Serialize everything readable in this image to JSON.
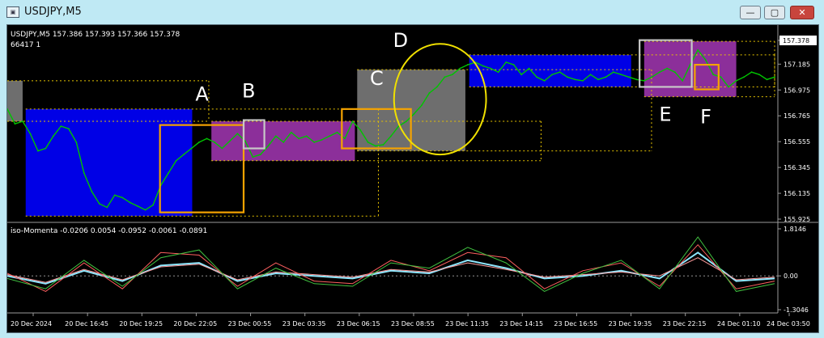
{
  "window": {
    "title": "USDJPY,M5",
    "icons": [
      "chart-window-icon",
      "minimize-icon",
      "maximize-icon",
      "close-icon"
    ],
    "buttons": {
      "minimize": "—",
      "maximize": "▢",
      "close": "✕"
    }
  },
  "colors": {
    "background": "#000000",
    "price_line": "#00c400",
    "blue_box": "#0000e6",
    "magenta_box": "#8c2f9a",
    "gray_box": "#6e6e6e",
    "orange": "#f5a300",
    "yellow": "#f0e000",
    "silver": "#c8c8c8",
    "dotted": "#e6c300",
    "momentum_red": "#ff6060",
    "momentum_pink": "#ff9c9c",
    "momentum_cyan": "#8fe8ff",
    "momentum_green": "#40c040"
  },
  "chart_data": [
    {
      "type": "line",
      "header": "USDJPY,M5  157.386 157.393 157.366 157.378",
      "subheader": "66417  1",
      "ylim": [
        155.925,
        157.45
      ],
      "y_ticks": [
        "157.378",
        "157.185",
        "156.975",
        "156.765",
        "156.555",
        "156.345",
        "156.135",
        "155.925"
      ],
      "y_tick_values": [
        157.378,
        157.185,
        156.975,
        156.765,
        156.555,
        156.345,
        156.135,
        155.925
      ],
      "current_price": "157.378",
      "x_ticks": [
        "20 Dec 2024",
        "20 Dec 16:45",
        "20 Dec 19:25",
        "20 Dec 22:05",
        "23 Dec 00:55",
        "23 Dec 03:35",
        "23 Dec 06:15",
        "23 Dec 08:55",
        "23 Dec 11:35",
        "23 Dec 14:15",
        "23 Dec 16:55",
        "23 Dec 19:35",
        "23 Dec 22:15",
        "24 Dec 01:10",
        "24 Dec 03:50"
      ],
      "x_range": [
        0,
        100
      ],
      "series": [
        {
          "x": [
            0,
            1,
            2,
            3,
            4,
            5,
            6,
            7,
            8,
            9,
            10,
            11,
            12,
            13,
            14,
            15,
            16,
            17,
            18,
            19,
            20,
            21,
            22,
            23,
            24,
            25,
            26,
            27,
            28,
            29,
            30,
            31,
            32,
            33,
            34,
            35,
            36,
            37,
            38,
            39,
            40,
            41,
            42,
            43,
            44,
            45,
            46,
            47,
            48,
            49,
            50,
            51,
            52,
            53,
            54,
            55,
            56,
            57,
            58,
            59,
            60,
            61,
            62,
            63,
            64,
            65,
            66,
            67,
            68,
            69,
            70,
            71,
            72,
            73,
            74,
            75,
            76,
            77,
            78,
            79,
            80,
            81,
            82,
            83,
            84,
            85,
            86,
            87,
            88,
            89,
            90,
            91,
            92,
            93,
            94,
            95,
            96,
            97,
            98,
            99,
            100
          ],
          "values": [
            156.82,
            156.7,
            156.72,
            156.62,
            156.48,
            156.5,
            156.6,
            156.68,
            156.66,
            156.55,
            156.3,
            156.15,
            156.05,
            156.02,
            156.12,
            156.1,
            156.06,
            156.03,
            156.0,
            156.04,
            156.2,
            156.3,
            156.4,
            156.45,
            156.5,
            156.55,
            156.58,
            156.55,
            156.5,
            156.56,
            156.62,
            156.56,
            156.43,
            156.45,
            156.52,
            156.6,
            156.55,
            156.63,
            156.58,
            156.6,
            156.55,
            156.57,
            156.6,
            156.63,
            156.58,
            156.72,
            156.65,
            156.55,
            156.52,
            156.53,
            156.6,
            156.68,
            156.72,
            156.78,
            156.85,
            156.95,
            157.0,
            157.08,
            157.1,
            157.15,
            157.18,
            157.2,
            157.17,
            157.15,
            157.12,
            157.2,
            157.18,
            157.1,
            157.15,
            157.08,
            157.05,
            157.1,
            157.12,
            157.08,
            157.06,
            157.05,
            157.1,
            157.06,
            157.08,
            157.12,
            157.1,
            157.08,
            157.06,
            157.05,
            157.08,
            157.12,
            157.15,
            157.12,
            157.05,
            157.18,
            157.3,
            157.22,
            157.1,
            157.08,
            157.0,
            157.05,
            157.08,
            157.12,
            157.1,
            157.06,
            157.08
          ]
        }
      ],
      "zones": [
        {
          "color": "gray",
          "x0": 0.0,
          "x1": 2.0,
          "y0": 156.72,
          "y1": 157.05
        },
        {
          "color": "blue",
          "x0": 2.4,
          "x1": 24.1,
          "y0": 155.95,
          "y1": 156.82
        },
        {
          "color": "magenta",
          "x0": 26.6,
          "x1": 45.3,
          "y0": 156.4,
          "y1": 156.72
        },
        {
          "color": "gray",
          "x0": 45.6,
          "x1": 59.7,
          "y0": 156.48,
          "y1": 157.14
        },
        {
          "color": "blue",
          "x0": 60.2,
          "x1": 81.3,
          "y0": 157.0,
          "y1": 157.26
        },
        {
          "color": "magenta",
          "x0": 83.0,
          "x1": 95.0,
          "y0": 156.92,
          "y1": 157.37
        }
      ],
      "boxes": [
        {
          "label": "A",
          "color": "orange",
          "x0": 19.9,
          "x1": 30.8,
          "y0": 155.98,
          "y1": 156.69
        },
        {
          "label": "B",
          "color": "silver",
          "x0": 30.8,
          "x1": 33.5,
          "y0": 156.5,
          "y1": 156.73
        },
        {
          "label": "C",
          "color": "orange",
          "x0": 43.6,
          "x1": 52.6,
          "y0": 156.5,
          "y1": 156.82
        },
        {
          "label": "E",
          "color": "silver",
          "x0": 82.4,
          "x1": 89.2,
          "y0": 157.0,
          "y1": 157.38
        },
        {
          "label": "F",
          "color": "orange",
          "x0": 89.6,
          "x1": 92.7,
          "y0": 156.98,
          "y1": 157.18
        }
      ],
      "ellipse": {
        "label": "D",
        "color": "yellow",
        "cx": 56.4,
        "cy": 156.9,
        "rx": 6.0,
        "ry": 0.45
      },
      "labels": [
        "A",
        "B",
        "C",
        "D",
        "E",
        "F"
      ]
    },
    {
      "type": "line",
      "title": "iso-Momenta -0.0206 0.0054 -0.0952 -0.0061 -0.0891",
      "ylim": [
        -1.3046,
        1.8146
      ],
      "y_ticks": [
        "1.8146",
        "0.00",
        "-1.3046"
      ],
      "y_tick_values": [
        1.8146,
        0.0,
        -1.3046
      ],
      "x_range": [
        0,
        100
      ],
      "series": [
        {
          "name": "",
          "color": "cyan",
          "x": [
            0,
            5,
            10,
            15,
            20,
            25,
            30,
            35,
            40,
            45,
            50,
            55,
            60,
            65,
            70,
            75,
            80,
            85,
            90,
            95,
            100
          ],
          "values": [
            0.0,
            -0.3,
            0.2,
            -0.2,
            0.4,
            0.5,
            -0.2,
            0.1,
            0.0,
            -0.1,
            0.2,
            0.1,
            0.6,
            0.3,
            -0.1,
            0.0,
            0.2,
            -0.1,
            0.9,
            -0.2,
            -0.1
          ]
        },
        {
          "name": "",
          "color": "pink",
          "x": [
            0,
            5,
            10,
            15,
            20,
            25,
            30,
            35,
            40,
            45,
            50,
            55,
            60,
            65,
            70,
            75,
            80,
            85,
            90,
            95,
            100
          ],
          "values": [
            0.05,
            -0.25,
            0.25,
            -0.15,
            0.35,
            0.45,
            -0.15,
            0.15,
            0.05,
            -0.05,
            0.25,
            0.15,
            0.5,
            0.25,
            -0.05,
            0.05,
            0.15,
            0.0,
            0.7,
            -0.15,
            -0.05
          ]
        },
        {
          "name": "",
          "color": "red",
          "x": [
            0,
            5,
            10,
            15,
            20,
            25,
            30,
            35,
            40,
            45,
            50,
            55,
            60,
            65,
            70,
            75,
            80,
            85,
            90,
            95,
            100
          ],
          "values": [
            0.1,
            -0.6,
            0.5,
            -0.5,
            0.9,
            0.8,
            -0.4,
            0.5,
            -0.2,
            -0.3,
            0.6,
            0.2,
            0.9,
            0.7,
            -0.5,
            0.2,
            0.5,
            -0.4,
            1.2,
            -0.5,
            -0.2
          ]
        },
        {
          "name": "",
          "color": "green",
          "x": [
            0,
            5,
            10,
            15,
            20,
            25,
            30,
            35,
            40,
            45,
            50,
            55,
            60,
            65,
            70,
            75,
            80,
            85,
            90,
            95,
            100
          ],
          "values": [
            -0.1,
            -0.5,
            0.6,
            -0.4,
            0.7,
            1.0,
            -0.5,
            0.3,
            -0.3,
            -0.4,
            0.5,
            0.3,
            1.1,
            0.5,
            -0.6,
            0.1,
            0.6,
            -0.5,
            1.5,
            -0.6,
            -0.3
          ]
        }
      ]
    }
  ]
}
